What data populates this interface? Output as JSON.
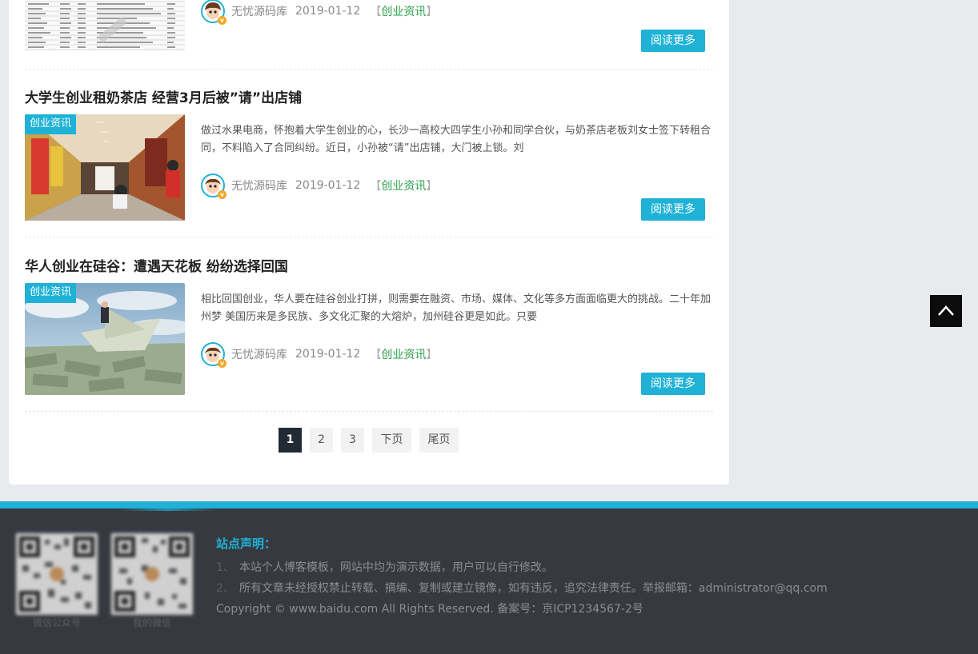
{
  "posts": [
    {
      "title": "",
      "excerpt": "",
      "author": "无忧源码库",
      "date": "2019-01-12",
      "category": "创业资讯",
      "read_more": "阅读更多"
    },
    {
      "title": "大学生创业租奶茶店 经营3月后被”请”出店铺",
      "tag": "创业资讯",
      "excerpt": "做过水果电商，怀抱着大学生创业的心，长沙一高校大四学生小孙和同学合伙，与奶茶店老板刘女士签下转租合同，不料陷入了合同纠纷。近日，小孙被“请”出店铺，大门被上锁。刘",
      "author": "无忧源码库",
      "date": "2019-01-12",
      "category": "创业资讯",
      "read_more": "阅读更多"
    },
    {
      "title": "华人创业在硅谷：遭遇天花板 纷纷选择回国",
      "tag": "创业资讯",
      "excerpt": "相比回国创业，华人要在硅谷创业打拼，则需要在融资、市场、媒体、文化等多方面面临更大的挑战。二十年加州梦 美国历来是多民族、多文化汇聚的大熔炉，加州硅谷更是如此。只要",
      "author": "无忧源码库",
      "date": "2019-01-12",
      "category": "创业资讯",
      "read_more": "阅读更多"
    }
  ],
  "meta_brackets": {
    "open": "【",
    "close": "】"
  },
  "pagination": {
    "current": "1",
    "pages": [
      "2",
      "3"
    ],
    "next": "下页",
    "last": "尾页"
  },
  "footer": {
    "qr_labels": [
      "微信公众号",
      "我的微信"
    ],
    "notice_title": "站点声明：",
    "lines": [
      {
        "num": "1、",
        "text": "本站个人博客模板，网站中均为演示数据，用户可以自行修改。"
      },
      {
        "num": "2、",
        "text": "所有文章未经授权禁止转载、摘编、复制或建立镜像，如有违反，追究法律责任。举报邮箱：administrator@qq.com"
      }
    ],
    "copyright": "Copyright © www.baidu.com All Rights Reserved. 备案号：京ICP1234567-2号"
  },
  "colors": {
    "accent": "#1fb2d6",
    "category_text": "#2aa14a",
    "footer_bg": "#363a40",
    "page_bg": "#e9eaed"
  },
  "icons": {
    "back_to_top": "chevron-up-icon",
    "verified": "v-badge-icon"
  }
}
